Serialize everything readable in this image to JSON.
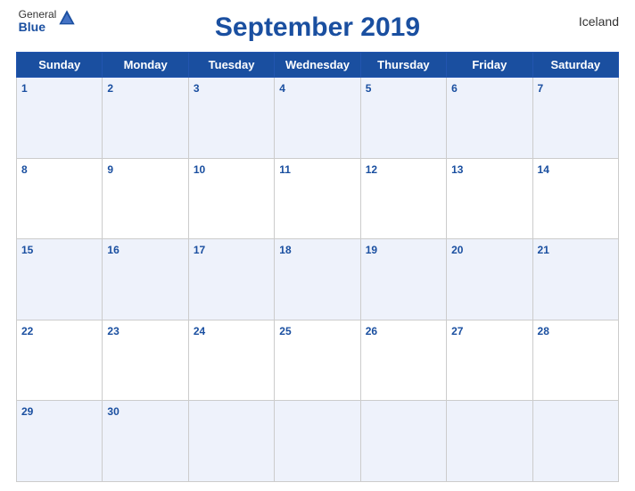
{
  "header": {
    "logo_general": "General",
    "logo_blue": "Blue",
    "title": "September 2019",
    "country": "Iceland"
  },
  "days_of_week": [
    "Sunday",
    "Monday",
    "Tuesday",
    "Wednesday",
    "Thursday",
    "Friday",
    "Saturday"
  ],
  "weeks": [
    [
      {
        "date": "1",
        "empty": false
      },
      {
        "date": "2",
        "empty": false
      },
      {
        "date": "3",
        "empty": false
      },
      {
        "date": "4",
        "empty": false
      },
      {
        "date": "5",
        "empty": false
      },
      {
        "date": "6",
        "empty": false
      },
      {
        "date": "7",
        "empty": false
      }
    ],
    [
      {
        "date": "8",
        "empty": false
      },
      {
        "date": "9",
        "empty": false
      },
      {
        "date": "10",
        "empty": false
      },
      {
        "date": "11",
        "empty": false
      },
      {
        "date": "12",
        "empty": false
      },
      {
        "date": "13",
        "empty": false
      },
      {
        "date": "14",
        "empty": false
      }
    ],
    [
      {
        "date": "15",
        "empty": false
      },
      {
        "date": "16",
        "empty": false
      },
      {
        "date": "17",
        "empty": false
      },
      {
        "date": "18",
        "empty": false
      },
      {
        "date": "19",
        "empty": false
      },
      {
        "date": "20",
        "empty": false
      },
      {
        "date": "21",
        "empty": false
      }
    ],
    [
      {
        "date": "22",
        "empty": false
      },
      {
        "date": "23",
        "empty": false
      },
      {
        "date": "24",
        "empty": false
      },
      {
        "date": "25",
        "empty": false
      },
      {
        "date": "26",
        "empty": false
      },
      {
        "date": "27",
        "empty": false
      },
      {
        "date": "28",
        "empty": false
      }
    ],
    [
      {
        "date": "29",
        "empty": false
      },
      {
        "date": "30",
        "empty": false
      },
      {
        "date": "",
        "empty": true
      },
      {
        "date": "",
        "empty": true
      },
      {
        "date": "",
        "empty": true
      },
      {
        "date": "",
        "empty": true
      },
      {
        "date": "",
        "empty": true
      }
    ]
  ],
  "colors": {
    "header_bg": "#1a4fa0",
    "row_odd_bg": "#dce6f7",
    "row_even_bg": "#ffffff",
    "day_num_color": "#1a4fa0"
  }
}
